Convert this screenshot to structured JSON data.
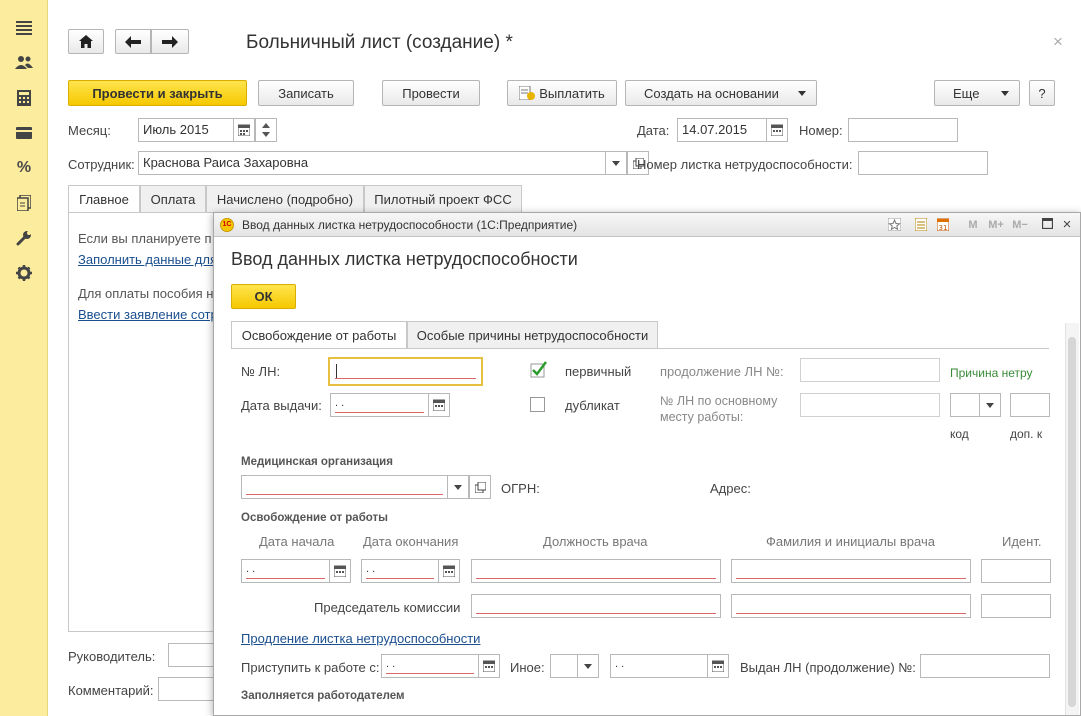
{
  "left_panel": {
    "icons": [
      "menu-icon",
      "users-icon",
      "calculator-icon",
      "card-icon",
      "percent-icon",
      "documents-icon",
      "wrench-icon",
      "gear-icon"
    ],
    "percent_glyph": "%"
  },
  "window": {
    "title": "Больничный лист (создание) *",
    "close_glyph": "×"
  },
  "toolbar": {
    "post_and_close": "Провести и закрыть",
    "save": "Записать",
    "post": "Провести",
    "pay": "Выплатить",
    "create_based_on": "Создать на основании",
    "more": "Еще",
    "help": "?"
  },
  "form": {
    "month_label": "Месяц:",
    "month_value": "Июль 2015",
    "date_label": "Дата:",
    "date_value": "14.07.2015",
    "number_label": "Номер:",
    "number_value": "",
    "employee_label": "Сотрудник:",
    "employee_value": "Краснова Раиса Захаровна",
    "sick_number_label": "Номер листка нетрудоспособности:",
    "sick_number_value": "",
    "manager_label": "Руководитель:",
    "comment_label": "Комментарий:"
  },
  "tabs": [
    "Главное",
    "Оплата",
    "Начислено (подробно)",
    "Пилотный проект ФСС"
  ],
  "main_tab": {
    "text1": "Если вы планируете п",
    "link1": "Заполнить данные для",
    "text2": "Для оплаты пособия н",
    "link2": "Ввести заявление сотр"
  },
  "dialog": {
    "title": "Ввод данных листка нетрудоспособности  (1С:Предприятие)",
    "heading": "Ввод данных листка нетрудоспособности",
    "ok": "ОК",
    "title_icons": [
      "star-icon",
      "list-icon",
      "calendar-icon",
      "m-icon",
      "m-plus-icon",
      "m-minus-icon",
      "maximize-icon",
      "close-icon"
    ],
    "title_glyphs": {
      "m": "M",
      "m_plus": "M+",
      "m_minus": "M−",
      "close": "×"
    },
    "tabs": [
      "Освобождение от работы",
      "Особые причины нетрудоспособности"
    ],
    "ln_label": "№ ЛН:",
    "ln_value": "",
    "issue_date_label": "Дата выдачи:",
    "date_placeholder": " .  .",
    "primary_label": "первичный",
    "primary_checked": true,
    "duplicate_label": "дубликат",
    "duplicate_checked": false,
    "continuation_label": "продолжение ЛН №:",
    "main_place_label": "№ ЛН по основному месту работы:",
    "reason_label": "Причина   нетру",
    "code_label": "код",
    "add_code_label": "доп. к",
    "med_org_section": "Медицинская организация",
    "ogrn_label": "ОГРН:",
    "address_label": "Адрес:",
    "release_section": "Освобождение от работы",
    "col_start": "Дата начала",
    "col_end": "Дата окончания",
    "col_position": "Должность врача",
    "col_doctor": "Фамилия и инициалы врача",
    "col_ident": "Идент.",
    "chairman_label": "Председатель комиссии",
    "extension_link": "Продление листка нетрудоспособности",
    "return_label": "Приступить к работе с:",
    "other_label": "Иное:",
    "issued_label": "Выдан ЛН (продолжение) №:",
    "employer_section": "Заполняется работодателем"
  }
}
